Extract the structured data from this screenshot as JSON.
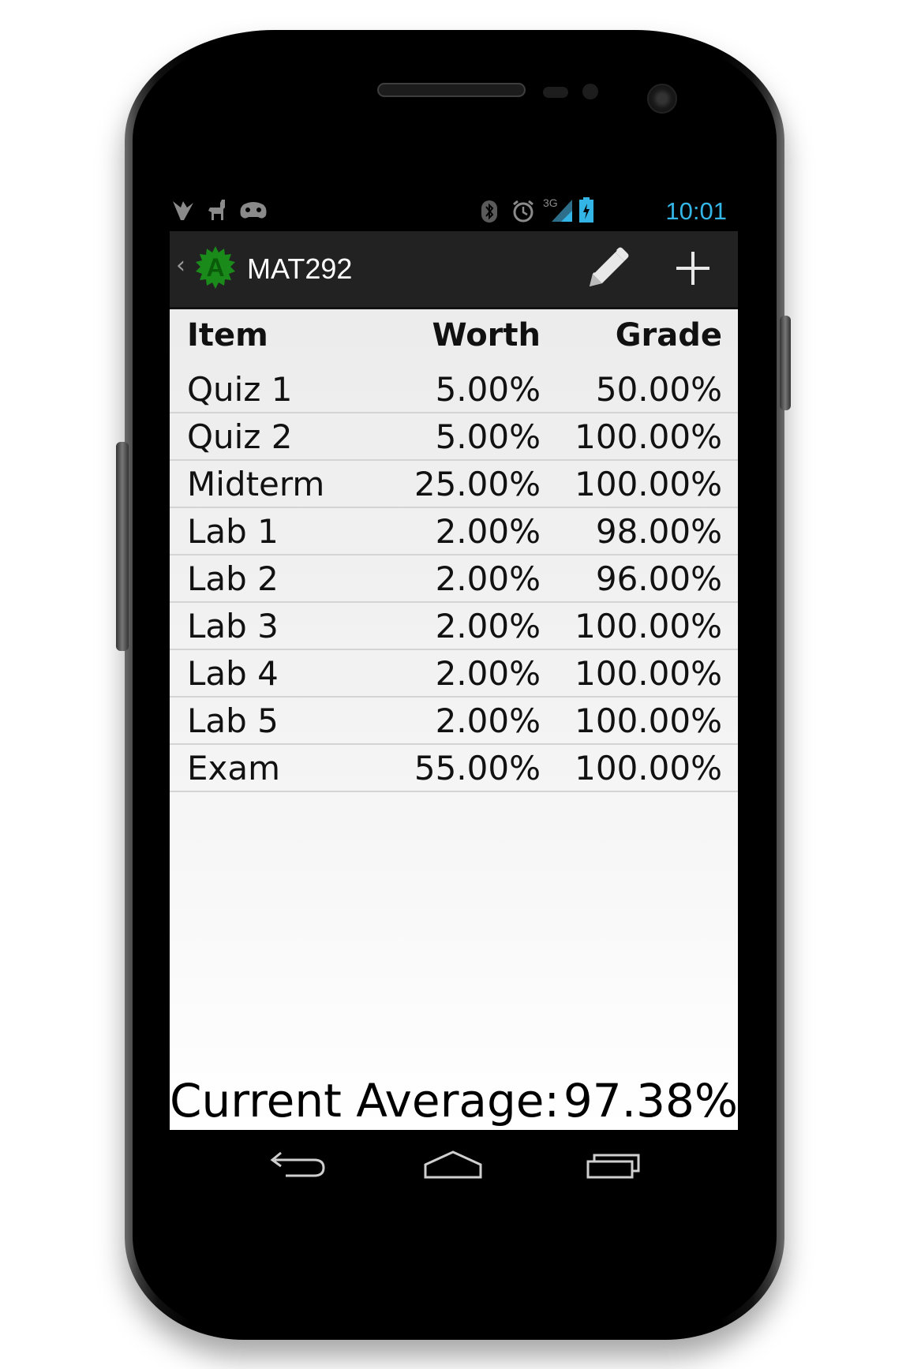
{
  "status_bar": {
    "time": "10:01",
    "network": "3G",
    "icons": [
      "feather-icon",
      "llama-icon",
      "game-controller-icon",
      "bluetooth-icon",
      "alarm-icon",
      "signal-icon",
      "battery-charging-icon"
    ]
  },
  "action_bar": {
    "app_icon_letter": "A",
    "title": "MAT292",
    "actions": [
      "edit-pencil-icon",
      "add-plus-icon"
    ]
  },
  "table": {
    "headers": {
      "item": "Item",
      "worth": "Worth",
      "grade": "Grade"
    },
    "rows": [
      {
        "item": "Quiz 1",
        "worth": "5.00%",
        "grade": "50.00%"
      },
      {
        "item": "Quiz 2",
        "worth": "5.00%",
        "grade": "100.00%"
      },
      {
        "item": "Midterm",
        "worth": "25.00%",
        "grade": "100.00%"
      },
      {
        "item": "Lab 1",
        "worth": "2.00%",
        "grade": "98.00%"
      },
      {
        "item": "Lab 2",
        "worth": "2.00%",
        "grade": "96.00%"
      },
      {
        "item": "Lab 3",
        "worth": "2.00%",
        "grade": "100.00%"
      },
      {
        "item": "Lab 4",
        "worth": "2.00%",
        "grade": "100.00%"
      },
      {
        "item": "Lab 5",
        "worth": "2.00%",
        "grade": "100.00%"
      },
      {
        "item": "Exam",
        "worth": "55.00%",
        "grade": "100.00%"
      }
    ]
  },
  "summary": {
    "label": "Current Average:",
    "value": "97.38%"
  },
  "nav_bar": {
    "buttons": [
      "back-icon",
      "home-icon",
      "recent-apps-icon"
    ]
  },
  "colors": {
    "clock": "#33b5e5",
    "action_bar": "#222222",
    "app_icon": "#1a8a1a"
  }
}
